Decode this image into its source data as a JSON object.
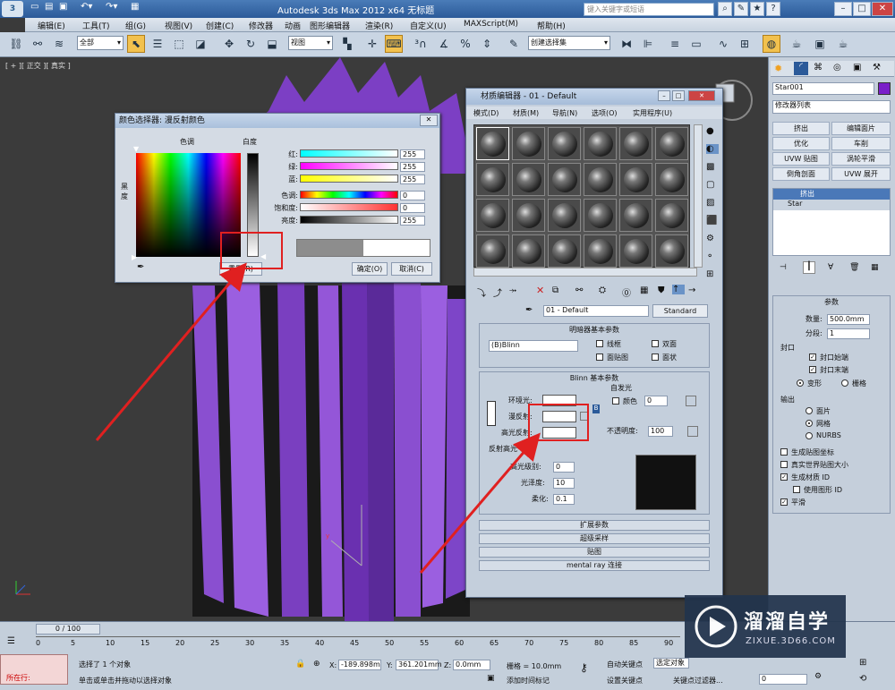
{
  "titlebar": {
    "app_title": "Autodesk 3ds Max  2012 x64    无标题",
    "search_placeholder": "键入关键字或短语"
  },
  "menubar": {
    "items": [
      "编辑(E)",
      "工具(T)",
      "组(G)",
      "视图(V)",
      "创建(C)",
      "修改器",
      "动画",
      "图形编辑器",
      "渲染(R)",
      "自定义(U)",
      "MAXScript(M)",
      "帮助(H)"
    ]
  },
  "toolbar": {
    "selection_filter": "全部",
    "ref_coord": "视图",
    "named_selection": "创建选择集"
  },
  "viewport": {
    "label": "[ + ][ 正交 ][ 真实 ]"
  },
  "command_panel": {
    "object_name": "Star001",
    "object_color": "#7a1fc9",
    "modifier_list": "修改器列表",
    "buttons": [
      "挤出",
      "编辑面片",
      "优化",
      "车削",
      "UVW 贴图",
      "涡轮平滑",
      "倒角剖面",
      "UVW 展开"
    ],
    "stack": [
      "挤出",
      "Star"
    ],
    "params_title": "参数",
    "amount_label": "数量:",
    "amount_value": "500.0mm",
    "segments_label": "分段:",
    "segments_value": "1",
    "capping_title": "封口",
    "cap_start": "封口始端",
    "cap_end": "封口末端",
    "morph": "变形",
    "grid": "栅格",
    "output_title": "输出",
    "output_patch": "面片",
    "output_mesh": "网格",
    "output_nurbs": "NURBS",
    "gen_mapping": "生成贴图坐标",
    "real_world": "真实世界贴图大小",
    "gen_mat_id": "生成材质 ID",
    "use_shape_id": "使用图形 ID",
    "smooth": "平滑"
  },
  "color_dialog": {
    "title": "颜色选择器: 漫反射颜色",
    "hue_label": "色调",
    "whiteness_label": "白度",
    "blackness_label": "黑度",
    "rows": [
      {
        "label": "红:",
        "value": "255"
      },
      {
        "label": "绿:",
        "value": "255"
      },
      {
        "label": "蓝:",
        "value": "255"
      },
      {
        "label": "色调:",
        "value": "0"
      },
      {
        "label": "饱和度:",
        "value": "0"
      },
      {
        "label": "亮度:",
        "value": "255"
      }
    ],
    "reset_button": "重置(R)",
    "ok_button": "确定(O)",
    "cancel_button": "取消(C)"
  },
  "material_editor": {
    "title": "材质编辑器 - 01 - Default",
    "menu": [
      "模式(D)",
      "材质(M)",
      "导航(N)",
      "选项(O)",
      "实用程序(U)"
    ],
    "material_name": "01 - Default",
    "material_type": "Standard",
    "shader_rollout": "明暗器基本参数",
    "shader": "(B)Blinn",
    "wire": "线框",
    "two_sided": "双面",
    "face_map": "面贴图",
    "faceted": "面状",
    "blinn_rollout": "Blinn 基本参数",
    "self_illum": "自发光",
    "color_label": "颜色",
    "self_illum_value": "0",
    "ambient": "环境光:",
    "diffuse": "漫反射:",
    "specular": "高光反射:",
    "opacity_label": "不透明度:",
    "opacity_value": "100",
    "spec_highlights": "反射高光",
    "spec_level_label": "高光级别:",
    "spec_level": "0",
    "glossiness_label": "光泽度:",
    "glossiness": "10",
    "soften_label": "柔化:",
    "soften": "0.1",
    "rollouts": [
      "扩展参数",
      "超级采样",
      "贴图",
      "mental ray 连接"
    ]
  },
  "status": {
    "frame_counter": "0 / 100",
    "selected": "选择了 1 个对象",
    "prompt": "单击或单击并拖动以选择对象",
    "x_value": "-189.898m",
    "y_value": "361.201mm",
    "z_value": "0.0mm",
    "grid": "栅格 = 10.0mm",
    "add_time_tag": "添加时间标记",
    "auto_key": "自动关键点",
    "selected_obj": "选定对象",
    "set_key": "设置关键点",
    "key_filter": "关键点过滤器...",
    "current_frame": "0",
    "in_progress": "所在行:",
    "x_label": "X:",
    "y_label": "Y:",
    "z_label": "Z:",
    "ticks": [
      "0",
      "5",
      "10",
      "15",
      "20",
      "25",
      "30",
      "35",
      "40",
      "45",
      "50",
      "55",
      "60",
      "65",
      "70",
      "75",
      "80",
      "85",
      "90"
    ]
  },
  "watermark": {
    "brand": "溜溜自学",
    "url": "ZIXUE.3D66.COM"
  },
  "colors": {
    "accent": "#e02020",
    "object": "#8a4fd0"
  }
}
